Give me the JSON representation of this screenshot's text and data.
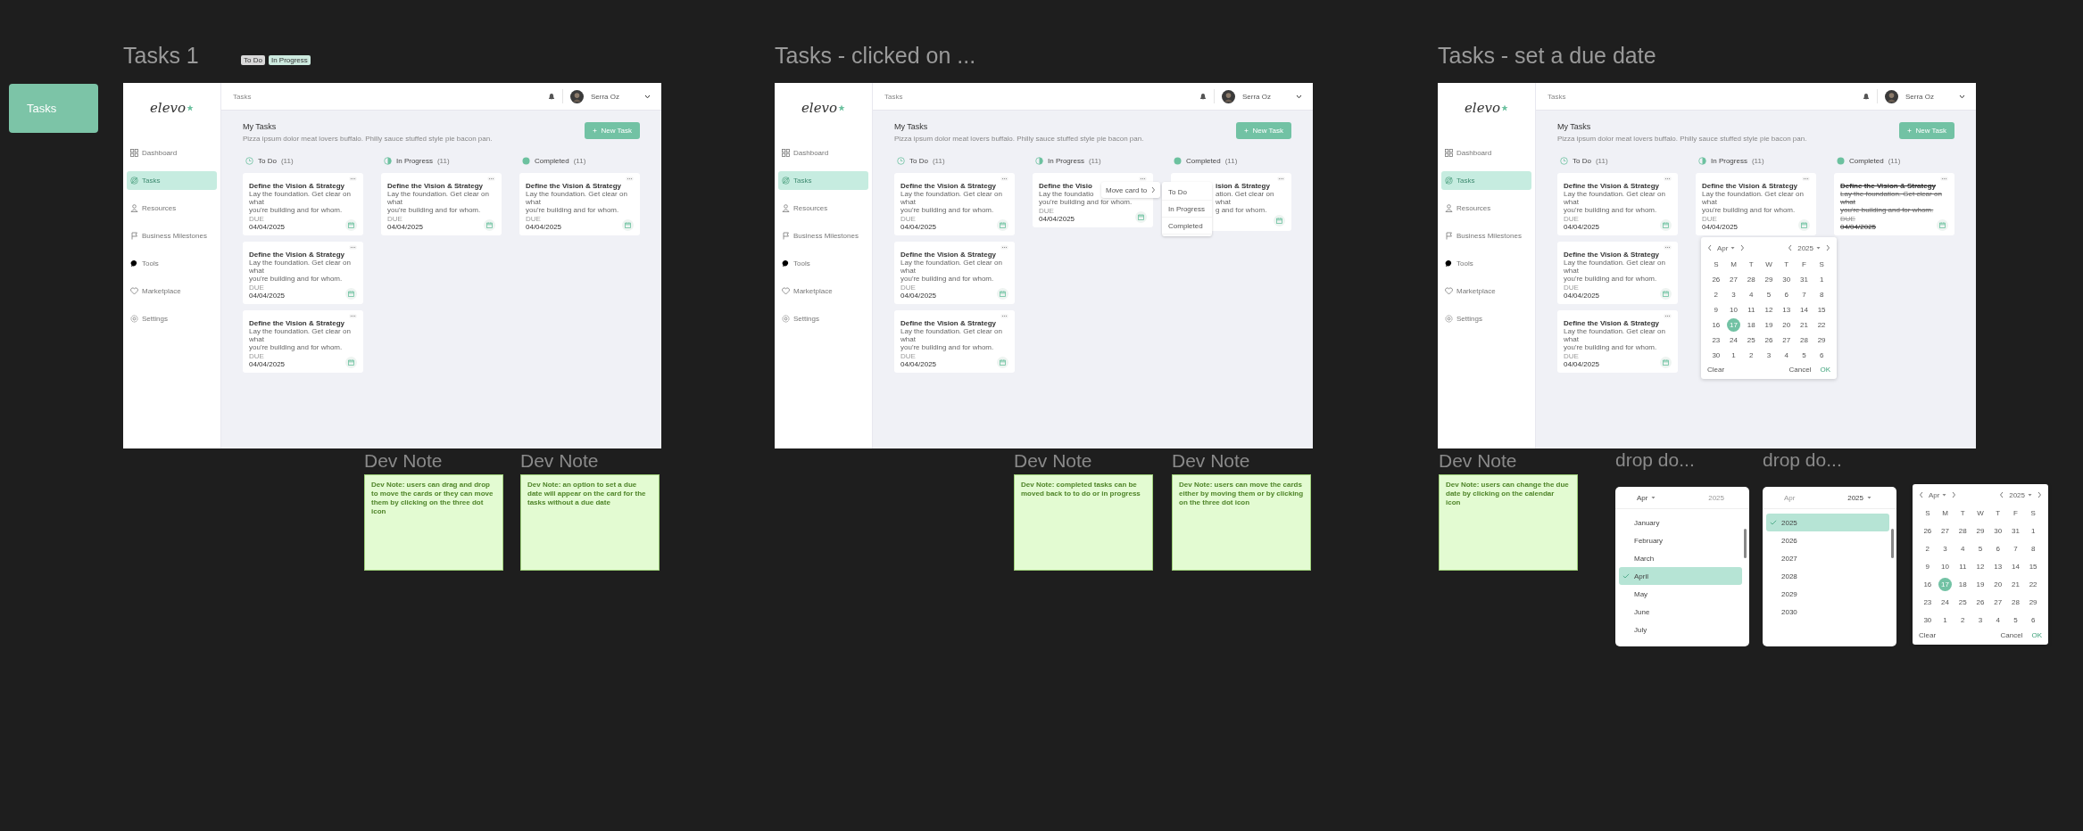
{
  "canvas_label": "Tasks",
  "frames": [
    {
      "title": "Tasks 1",
      "tags": [
        {
          "label": "To Do",
          "color": "#d9d9d9"
        },
        {
          "label": "In Progress",
          "color": "#cdeadf"
        }
      ],
      "app": {
        "logo": "elevo",
        "breadcrumb": "Tasks",
        "user": "Serra Oz",
        "heading": "My Tasks",
        "subtitle": "Pizza ipsum dolor meat lovers buffalo. Philly sauce stuffed style pie bacon pan.",
        "new_task": "New Task",
        "nav": [
          {
            "label": "Dashboard",
            "kind": "dashboard",
            "selected": false
          },
          {
            "label": "Tasks",
            "kind": "tasks",
            "selected": true
          },
          {
            "label": "Resources",
            "kind": "resources",
            "selected": false
          },
          {
            "label": "Business Milestones",
            "kind": "milestones",
            "selected": false
          },
          {
            "label": "Tools",
            "kind": "tools",
            "selected": false
          },
          {
            "label": "Marketplace",
            "kind": "marketplace",
            "selected": false
          },
          {
            "label": "Settings",
            "kind": "settings",
            "selected": false
          }
        ],
        "columns": [
          {
            "name": "To Do",
            "count": "(11)",
            "kind": "todo",
            "cards": [
              {
                "kind": "full",
                "title": "Define the Vision & Strategy",
                "lines": [
                  "Lay the foundation. Get clear on what",
                  "you're building and for whom."
                ],
                "due_label": "DUE",
                "date": "04/04/2025"
              },
              {
                "kind": "full",
                "title": "Define the Vision & Strategy",
                "lines": [
                  "Lay the foundation. Get clear on what",
                  "you're building and for whom."
                ],
                "due_label": "DUE",
                "date": "04/04/2025"
              },
              {
                "kind": "full",
                "title": "Define the Vision & Strategy",
                "lines": [
                  "Lay the foundation. Get clear on what",
                  "you're building and for whom."
                ],
                "due_label": "DUE",
                "date": "04/04/2025"
              }
            ]
          },
          {
            "name": "In Progress",
            "count": "(11)",
            "kind": "progress",
            "cards": [
              {
                "kind": "full",
                "title": "Define the Vision & Strategy",
                "lines": [
                  "Lay the foundation. Get clear on what",
                  "you're building and for whom."
                ],
                "due_label": "DUE",
                "date": "04/04/2025"
              }
            ]
          },
          {
            "name": "Completed",
            "count": "(11)",
            "kind": "done",
            "cards": [
              {
                "kind": "full",
                "struck": false,
                "title": "Define the Vision & Strategy",
                "lines": [
                  "Lay the foundation. Get clear on what",
                  "you're building and for whom."
                ],
                "due_label": "DUE",
                "date": "04/04/2025"
              }
            ]
          }
        ]
      }
    },
    {
      "title": "Tasks - clicked on ...",
      "app": {
        "logo": "elevo",
        "breadcrumb": "Tasks",
        "user": "Serra Oz",
        "heading": "My Tasks",
        "subtitle": "Pizza ipsum dolor meat lovers buffalo. Philly sauce stuffed style pie bacon pan.",
        "new_task": "New Task",
        "nav": [
          {
            "label": "Dashboard",
            "kind": "dashboard",
            "selected": false
          },
          {
            "label": "Tasks",
            "kind": "tasks",
            "selected": true
          },
          {
            "label": "Resources",
            "kind": "resources",
            "selected": false
          },
          {
            "label": "Business Milestones",
            "kind": "milestones",
            "selected": false
          },
          {
            "label": "Tools",
            "kind": "tools",
            "selected": false
          },
          {
            "label": "Marketplace",
            "kind": "marketplace",
            "selected": false
          },
          {
            "label": "Settings",
            "kind": "settings",
            "selected": false
          }
        ],
        "columns": [
          {
            "name": "To Do",
            "count": "(11)",
            "kind": "todo",
            "cards": [
              {
                "kind": "full",
                "title": "Define the Vision & Strategy",
                "lines": [
                  "Lay the foundation. Get clear on what",
                  "you're building and for whom."
                ],
                "due_label": "DUE",
                "date": "04/04/2025"
              },
              {
                "kind": "full",
                "title": "Define the Vision & Strategy",
                "lines": [
                  "Lay the foundation. Get clear on what",
                  "you're building and for whom."
                ],
                "due_label": "DUE",
                "date": "04/04/2025"
              },
              {
                "kind": "full",
                "title": "Define the Vision & Strategy",
                "lines": [
                  "Lay the foundation. Get clear on what",
                  "you're building and for whom."
                ],
                "due_label": "DUE",
                "date": "04/04/2025"
              }
            ]
          },
          {
            "name": "In Progress",
            "count": "(11)",
            "kind": "progress",
            "cards": [
              {
                "kind": "full",
                "title": "Define the Visio",
                "lines": [
                  "Lay the foundatio",
                  "you're building and for whom."
                ],
                "due_label": "DUE",
                "date": "04/04/2025",
                "menu": {
                  "label": "Move card to",
                  "options": [
                    "To Do",
                    "In Progress",
                    "Completed"
                  ]
                }
              }
            ]
          },
          {
            "name": "Completed",
            "count": "(11)",
            "kind": "done",
            "cards": [
              {
                "kind": "covered",
                "struck": false,
                "title": "ision & Strategy",
                "lines": [
                  "ation. Get clear on what",
                  "g and for whom."
                ]
              }
            ]
          }
        ]
      }
    },
    {
      "title": "Tasks - set a due date",
      "app": {
        "logo": "elevo",
        "breadcrumb": "Tasks",
        "user": "Serra Oz",
        "heading": "My Tasks",
        "subtitle": "Pizza ipsum dolor meat lovers buffalo. Philly sauce stuffed style pie bacon pan.",
        "new_task": "New Task",
        "nav": [
          {
            "label": "Dashboard",
            "kind": "dashboard",
            "selected": false
          },
          {
            "label": "Tasks",
            "kind": "tasks",
            "selected": true
          },
          {
            "label": "Resources",
            "kind": "resources",
            "selected": false
          },
          {
            "label": "Business Milestones",
            "kind": "milestones",
            "selected": false
          },
          {
            "label": "Tools",
            "kind": "tools",
            "selected": false
          },
          {
            "label": "Marketplace",
            "kind": "marketplace",
            "selected": false
          },
          {
            "label": "Settings",
            "kind": "settings",
            "selected": false
          }
        ],
        "columns": [
          {
            "name": "To Do",
            "count": "(11)",
            "kind": "todo",
            "cards": [
              {
                "kind": "full",
                "title": "Define the Vision & Strategy",
                "lines": [
                  "Lay the foundation. Get clear on what",
                  "you're building and for whom."
                ],
                "due_label": "DUE",
                "date": "04/04/2025"
              },
              {
                "kind": "full",
                "title": "Define the Vision & Strategy",
                "lines": [
                  "Lay the foundation. Get clear on what",
                  "you're building and for whom."
                ],
                "due_label": "DUE",
                "date": "04/04/2025"
              },
              {
                "kind": "full",
                "title": "Define the Vision & Strategy",
                "lines": [
                  "Lay the foundation. Get clear on what",
                  "you're building and for whom."
                ],
                "due_label": "DUE",
                "date": "04/04/2025"
              }
            ]
          },
          {
            "name": "In Progress",
            "count": "(11)",
            "kind": "progress",
            "cards": [
              {
                "kind": "full",
                "title": "Define the Vision & Strategy",
                "lines": [
                  "Lay the foundation. Get clear on what",
                  "you're building and for whom."
                ],
                "due_label": "DUE",
                "date": "04/04/2025",
                "calendar": {
                  "month": "Apr",
                  "year": "2025",
                  "weekdays": [
                    "S",
                    "M",
                    "T",
                    "W",
                    "T",
                    "F",
                    "S"
                  ],
                  "weeks": [
                    [
                      {
                        "day": "26",
                        "selected": false
                      },
                      {
                        "day": "27",
                        "selected": false
                      },
                      {
                        "day": "28",
                        "selected": false
                      },
                      {
                        "day": "29",
                        "selected": false
                      },
                      {
                        "day": "30",
                        "selected": false
                      },
                      {
                        "day": "31",
                        "selected": false
                      },
                      {
                        "day": "1",
                        "selected": false
                      }
                    ],
                    [
                      {
                        "day": "2",
                        "selected": false
                      },
                      {
                        "day": "3",
                        "selected": false
                      },
                      {
                        "day": "4",
                        "selected": false
                      },
                      {
                        "day": "5",
                        "selected": false
                      },
                      {
                        "day": "6",
                        "selected": false
                      },
                      {
                        "day": "7",
                        "selected": false
                      },
                      {
                        "day": "8",
                        "selected": false
                      }
                    ],
                    [
                      {
                        "day": "9",
                        "selected": false
                      },
                      {
                        "day": "10",
                        "selected": false
                      },
                      {
                        "day": "11",
                        "selected": false
                      },
                      {
                        "day": "12",
                        "selected": false
                      },
                      {
                        "day": "13",
                        "selected": false
                      },
                      {
                        "day": "14",
                        "selected": false
                      },
                      {
                        "day": "15",
                        "selected": false
                      }
                    ],
                    [
                      {
                        "day": "16",
                        "selected": false
                      },
                      {
                        "day": "17",
                        "selected": true
                      },
                      {
                        "day": "18",
                        "selected": false
                      },
                      {
                        "day": "19",
                        "selected": false
                      },
                      {
                        "day": "20",
                        "selected": false
                      },
                      {
                        "day": "21",
                        "selected": false
                      },
                      {
                        "day": "22",
                        "selected": false
                      }
                    ],
                    [
                      {
                        "day": "23",
                        "selected": false
                      },
                      {
                        "day": "24",
                        "selected": false
                      },
                      {
                        "day": "25",
                        "selected": false
                      },
                      {
                        "day": "26",
                        "selected": false
                      },
                      {
                        "day": "27",
                        "selected": false
                      },
                      {
                        "day": "28",
                        "selected": false
                      },
                      {
                        "day": "29",
                        "selected": false
                      }
                    ],
                    [
                      {
                        "day": "30",
                        "selected": false
                      },
                      {
                        "day": "1",
                        "selected": false
                      },
                      {
                        "day": "2",
                        "selected": false
                      },
                      {
                        "day": "3",
                        "selected": false
                      },
                      {
                        "day": "4",
                        "selected": false
                      },
                      {
                        "day": "5",
                        "selected": false
                      },
                      {
                        "day": "6",
                        "selected": false
                      }
                    ]
                  ],
                  "clear": "Clear",
                  "cancel": "Cancel",
                  "ok": "OK"
                }
              }
            ]
          },
          {
            "name": "Completed",
            "count": "(11)",
            "kind": "done",
            "cards": [
              {
                "kind": "full",
                "struck": true,
                "title": "Define the Vision & Strategy",
                "lines": [
                  "Lay the foundation. Get clear on what",
                  "you're building and for whom."
                ],
                "due_label": "DUE",
                "date": "04/04/2025"
              }
            ]
          }
        ]
      }
    }
  ],
  "dev_notes": [
    {
      "title": "Dev Note",
      "text": "Dev Note: users can drag and drop to move the cards or they can move them by clicking on the three dot icon"
    },
    {
      "title": "Dev Note",
      "text": "Dev Note: an option to set a due date will appear on the card for the tasks without a due date"
    },
    {
      "title": "Dev Note",
      "text": "Dev Note: completed tasks can be moved back to to do or in progress"
    },
    {
      "title": "Dev Note",
      "text": "Dev Note: users can move the cards either by moving them or by clicking on the three dot icon"
    },
    {
      "title": "Dev Note",
      "text": "Dev Note: users can change the due date by clicking on the calendar icon"
    }
  ],
  "dropdowns": [
    {
      "title": "drop do...",
      "month": {
        "text": "Apr",
        "active": true
      },
      "year": {
        "text": "2025",
        "active": false
      },
      "options": [
        {
          "label": "January",
          "selected": false
        },
        {
          "label": "February",
          "selected": false
        },
        {
          "label": "March",
          "selected": false
        },
        {
          "label": "April",
          "selected": true
        },
        {
          "label": "May",
          "selected": false
        },
        {
          "label": "June",
          "selected": false
        },
        {
          "label": "July",
          "selected": false
        }
      ]
    },
    {
      "title": "drop do...",
      "month": {
        "text": "Apr",
        "active": false
      },
      "year": {
        "text": "2025",
        "active": true
      },
      "options": [
        {
          "label": "2025",
          "selected": true
        },
        {
          "label": "2026",
          "selected": false
        },
        {
          "label": "2027",
          "selected": false
        },
        {
          "label": "2028",
          "selected": false
        },
        {
          "label": "2029",
          "selected": false
        },
        {
          "label": "2030",
          "selected": false
        }
      ]
    }
  ],
  "calendar": {
    "month": "Apr",
    "year": "2025",
    "weekdays": [
      "S",
      "M",
      "T",
      "W",
      "T",
      "F",
      "S"
    ],
    "weeks": [
      [
        {
          "day": "26",
          "selected": false
        },
        {
          "day": "27",
          "selected": false
        },
        {
          "day": "28",
          "selected": false
        },
        {
          "day": "29",
          "selected": false
        },
        {
          "day": "30",
          "selected": false
        },
        {
          "day": "31",
          "selected": false
        },
        {
          "day": "1",
          "selected": false
        }
      ],
      [
        {
          "day": "2",
          "selected": false
        },
        {
          "day": "3",
          "selected": false
        },
        {
          "day": "4",
          "selected": false
        },
        {
          "day": "5",
          "selected": false
        },
        {
          "day": "6",
          "selected": false
        },
        {
          "day": "7",
          "selected": false
        },
        {
          "day": "8",
          "selected": false
        }
      ],
      [
        {
          "day": "9",
          "selected": false
        },
        {
          "day": "10",
          "selected": false
        },
        {
          "day": "11",
          "selected": false
        },
        {
          "day": "12",
          "selected": false
        },
        {
          "day": "13",
          "selected": false
        },
        {
          "day": "14",
          "selected": false
        },
        {
          "day": "15",
          "selected": false
        }
      ],
      [
        {
          "day": "16",
          "selected": false
        },
        {
          "day": "17",
          "selected": true
        },
        {
          "day": "18",
          "selected": false
        },
        {
          "day": "19",
          "selected": false
        },
        {
          "day": "20",
          "selected": false
        },
        {
          "day": "21",
          "selected": false
        },
        {
          "day": "22",
          "selected": false
        }
      ],
      [
        {
          "day": "23",
          "selected": false
        },
        {
          "day": "24",
          "selected": false
        },
        {
          "day": "25",
          "selected": false
        },
        {
          "day": "26",
          "selected": false
        },
        {
          "day": "27",
          "selected": false
        },
        {
          "day": "28",
          "selected": false
        },
        {
          "day": "29",
          "selected": false
        }
      ],
      [
        {
          "day": "30",
          "selected": false
        },
        {
          "day": "1",
          "selected": false
        },
        {
          "day": "2",
          "selected": false
        },
        {
          "day": "3",
          "selected": false
        },
        {
          "day": "4",
          "selected": false
        },
        {
          "day": "5",
          "selected": false
        },
        {
          "day": "6",
          "selected": false
        }
      ]
    ],
    "clear": "Clear",
    "cancel": "Cancel",
    "ok": "OK"
  }
}
